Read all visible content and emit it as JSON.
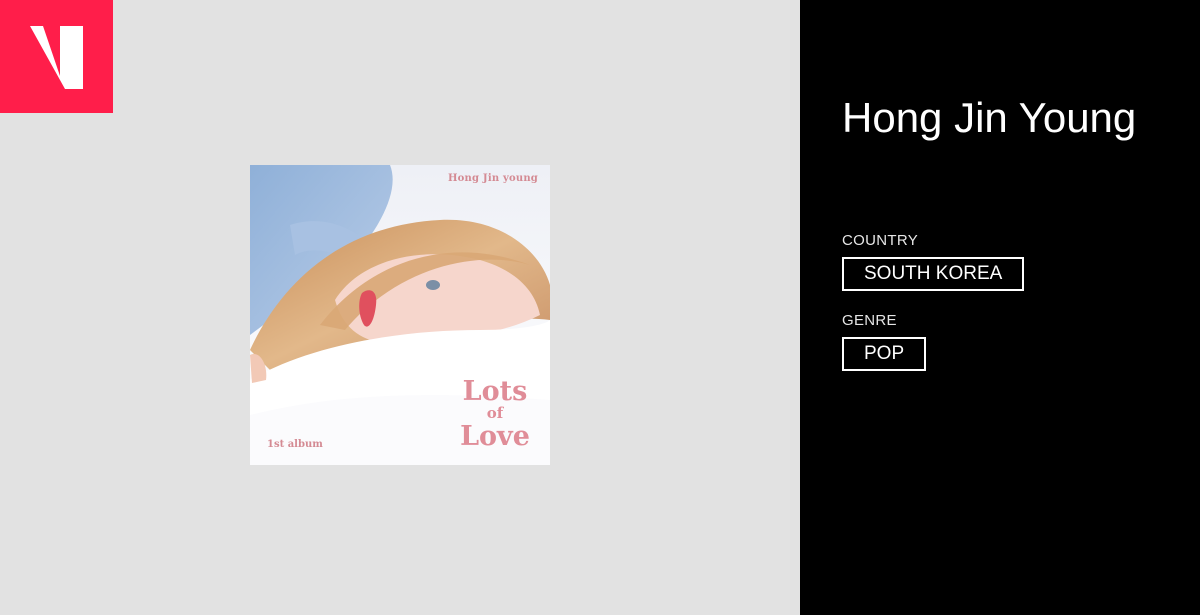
{
  "logo": {
    "icon": "v-logo-icon",
    "color": "#ff1e4a"
  },
  "album": {
    "cover_artist": "Hong Jin young",
    "cover_title_line1": "Lots",
    "cover_title_line2": "of",
    "cover_title_line3": "Love",
    "cover_edition": "1st album"
  },
  "artist": {
    "name": "Hong Jin Young",
    "country_label": "COUNTRY",
    "country": "SOUTH KOREA",
    "genre_label": "GENRE",
    "genre": "POP"
  },
  "colors": {
    "left_background": "#e2e2e2",
    "right_background": "#000000",
    "accent": "#ff1e4a"
  }
}
